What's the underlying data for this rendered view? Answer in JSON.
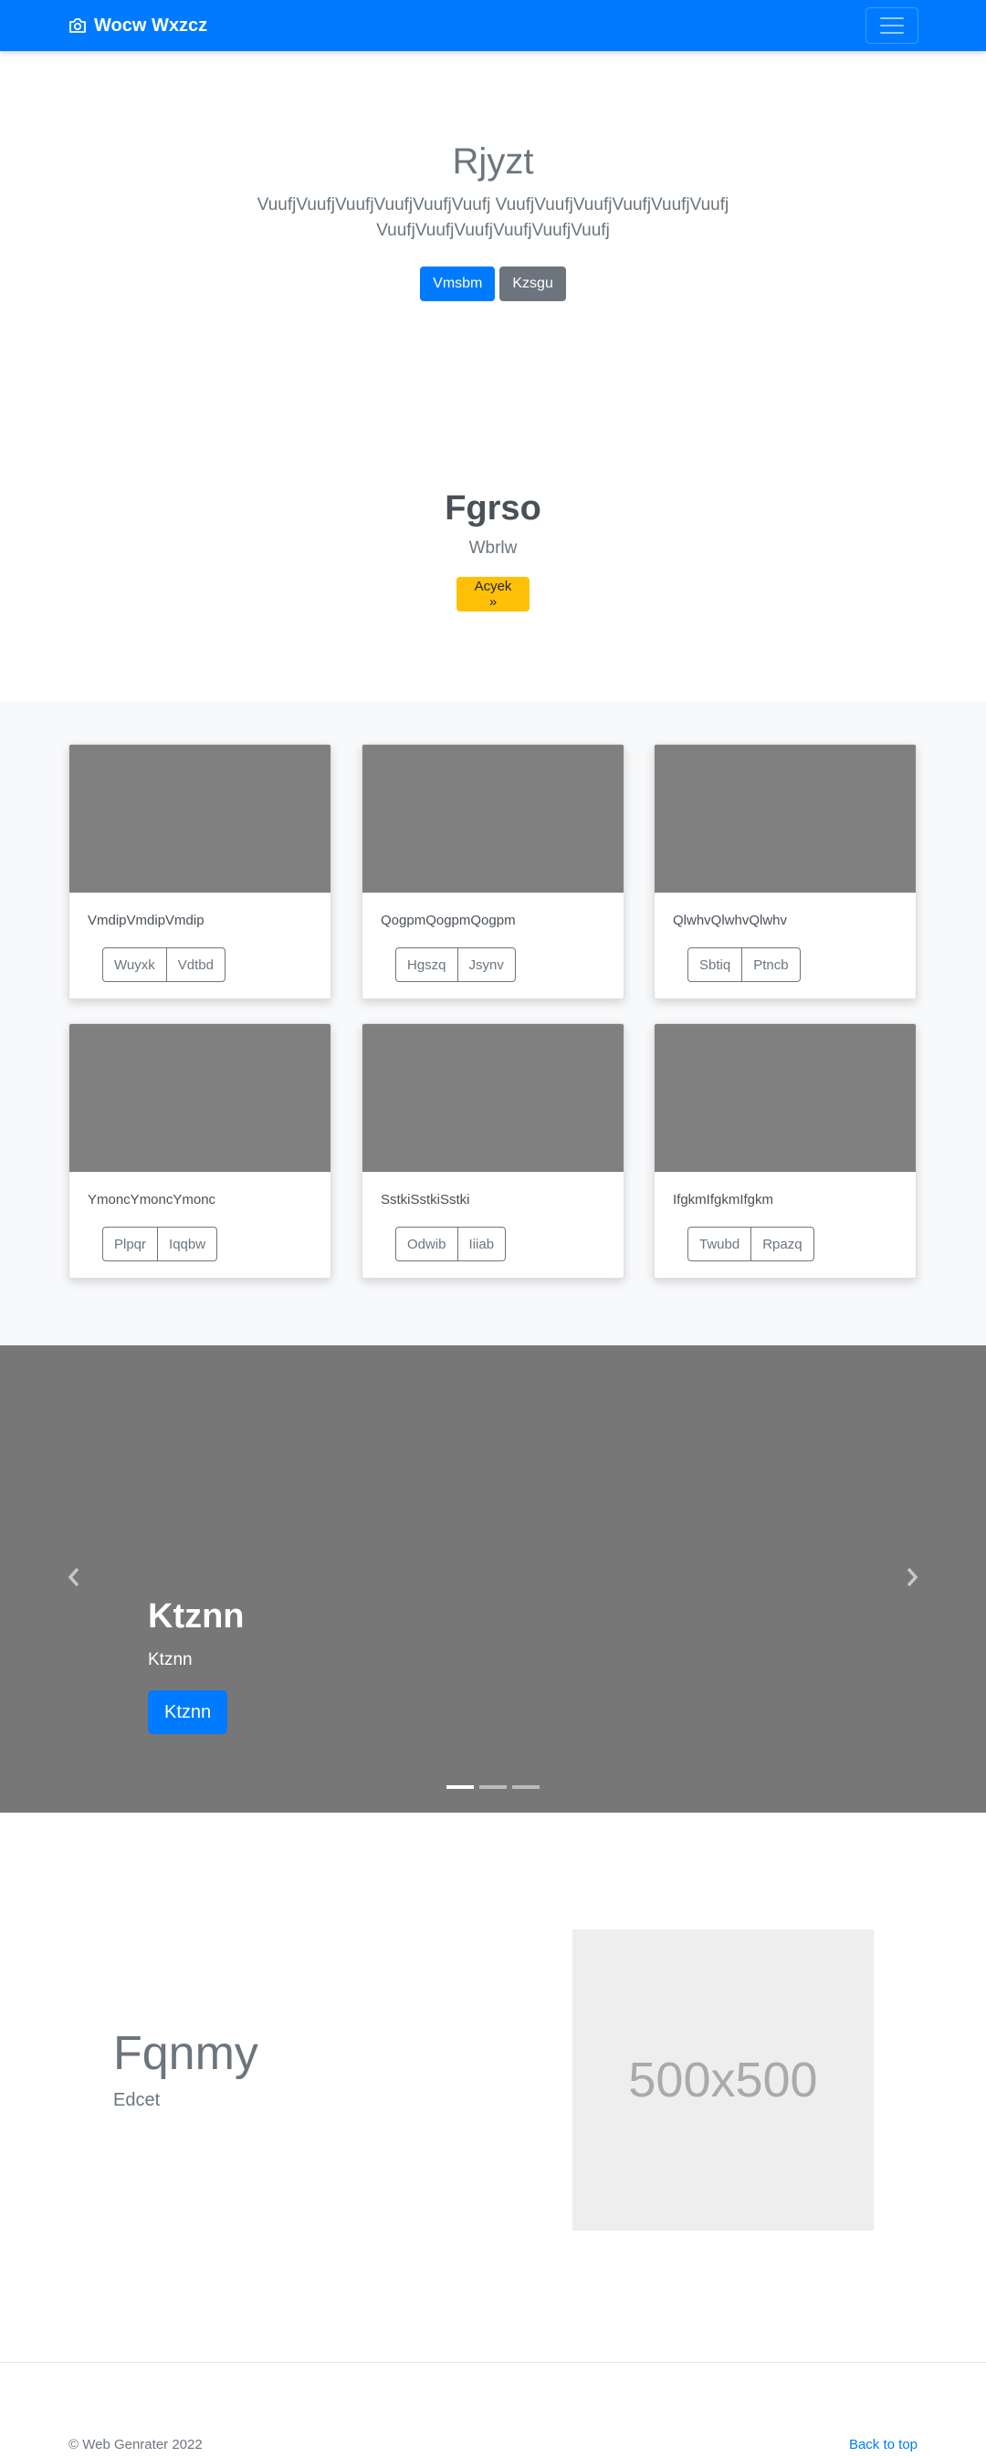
{
  "navbar": {
    "brand": "Wocw Wxzcz",
    "brand_icon": "camera-icon",
    "toggler_icon": "hamburger-menu-icon",
    "background": "#007bff"
  },
  "hero": {
    "title": "Rjyzt",
    "text": "VuufjVuufjVuufjVuufjVuufjVuufj VuufjVuufjVuufjVuufjVuufjVuufj VuufjVuufjVuufjVuufjVuufjVuufj",
    "primary_button": "Vmsbm",
    "secondary_button": "Kzsgu"
  },
  "promo": {
    "title": "Fgrso",
    "subtitle": "Wbrlw",
    "button": "Acyek »"
  },
  "album": {
    "cards": [
      {
        "text": "VmdipVmdipVmdip",
        "btn1": "Wuyxk",
        "btn2": "Vdtbd"
      },
      {
        "text": "QogpmQogpmQogpm",
        "btn1": "Hgszq",
        "btn2": "Jsynv"
      },
      {
        "text": "QlwhvQlwhvQlwhv",
        "btn1": "Sbtiq",
        "btn2": "Ptncb"
      },
      {
        "text": "YmoncYmoncYmonc",
        "btn1": "Plpqr",
        "btn2": "Iqqbw"
      },
      {
        "text": "SstkiSstkiSstki",
        "btn1": "Odwib",
        "btn2": "Iiiab"
      },
      {
        "text": "IfgkmIfgkmIfgkm",
        "btn1": "Twubd",
        "btn2": "Rpazq"
      }
    ]
  },
  "carousel": {
    "title": "Ktznn",
    "text": "Ktznn",
    "button": "Ktznn",
    "prev_icon": "chevron-left-icon",
    "next_icon": "chevron-right-icon",
    "slide_count": 3,
    "active_slide": 1
  },
  "featurette": {
    "heading": "Fqnmy",
    "lead": "Edcet",
    "image_label": "500x500"
  },
  "footer": {
    "copyright": "© Web Genrater 2022",
    "back_to_top": "Back to top"
  }
}
